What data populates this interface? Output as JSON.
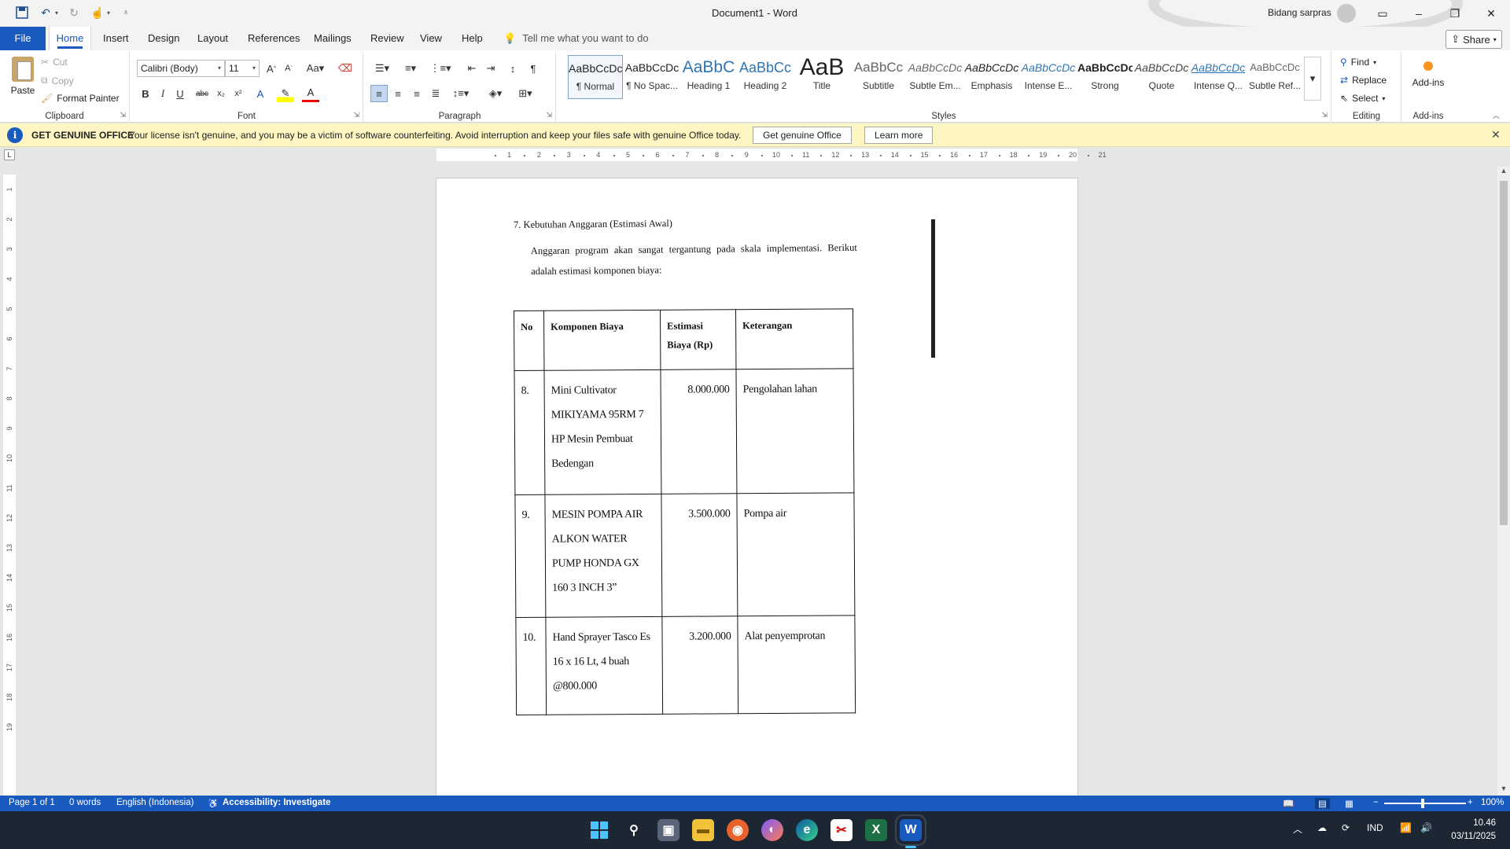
{
  "window": {
    "title": "Document1  -  Word",
    "user": "Bidang sarpras",
    "controls": {
      "minimize": "–",
      "restore": "❐",
      "close": "✕"
    }
  },
  "tabs": [
    {
      "label": "File"
    },
    {
      "label": "Home"
    },
    {
      "label": "Insert"
    },
    {
      "label": "Design"
    },
    {
      "label": "Layout"
    },
    {
      "label": "References"
    },
    {
      "label": "Mailings"
    },
    {
      "label": "Review"
    },
    {
      "label": "View"
    },
    {
      "label": "Help"
    }
  ],
  "tellme": "Tell me what you want to do",
  "share": "Share",
  "clipboard": {
    "paste": "Paste",
    "cut": "Cut",
    "copy": "Copy",
    "format_painter": "Format Painter",
    "group": "Clipboard"
  },
  "font": {
    "name": "Calibri (Body)",
    "size": "11",
    "group": "Font"
  },
  "paragraph": {
    "group": "Paragraph"
  },
  "styles": {
    "group": "Styles",
    "items": [
      {
        "preview": "AaBbCcDc",
        "name": "¶ Normal"
      },
      {
        "preview": "AaBbCcDc",
        "name": "¶ No Spac..."
      },
      {
        "preview": "AaBbC",
        "name": "Heading 1"
      },
      {
        "preview": "AaBbCc",
        "name": "Heading 2"
      },
      {
        "preview": "AaB",
        "name": "Title"
      },
      {
        "preview": "AaBbCc",
        "name": "Subtitle"
      },
      {
        "preview": "AaBbCcDc",
        "name": "Subtle Em..."
      },
      {
        "preview": "AaBbCcDc",
        "name": "Emphasis"
      },
      {
        "preview": "AaBbCcDc",
        "name": "Intense E..."
      },
      {
        "preview": "AaBbCcDc",
        "name": "Strong"
      },
      {
        "preview": "AaBbCcDc",
        "name": "Quote"
      },
      {
        "preview": "AaBbCcDc",
        "name": "Intense Q..."
      },
      {
        "preview": "AaBbCcDc",
        "name": "Subtle Ref..."
      }
    ]
  },
  "editing": {
    "find": "Find",
    "replace": "Replace",
    "select": "Select",
    "group": "Editing"
  },
  "addins": {
    "label": "Add-ins",
    "group": "Add-ins"
  },
  "notice": {
    "title": "GET GENUINE OFFICE",
    "message": "Your license isn't genuine, and you may be a victim of software counterfeiting. Avoid interruption and keep your files safe with genuine Office today.",
    "primary": "Get genuine Office",
    "secondary": "Learn more"
  },
  "document": {
    "heading": "7. Kebutuhan Anggaran (Estimasi Awal)",
    "paragraph": "Anggaran program akan sangat tergantung pada skala implementasi. Berikut adalah estimasi komponen biaya:",
    "table": {
      "headers": [
        "No",
        "Komponen Biaya",
        "Estimasi Biaya (Rp)",
        "Keterangan"
      ],
      "rows": [
        {
          "no": "8.",
          "komponen": "Mini Cultivator MIKIYAMA 95RM 7 HP Mesin Pembuat Bedengan",
          "biaya": "8.000.000",
          "keterangan": "Pengolahan lahan"
        },
        {
          "no": "9.",
          "komponen": "MESIN POMPA AIR ALKON WATER PUMP HONDA GX 160 3 INCH 3”",
          "biaya": "3.500.000",
          "keterangan": "Pompa air"
        },
        {
          "no": "10.",
          "komponen": "Hand Sprayer Tasco Es 16 x 16 Lt, 4 buah @800.000",
          "biaya": "3.200.000",
          "keterangan": "Alat penyemprotan"
        }
      ]
    }
  },
  "status": {
    "page": "Page 1 of 1",
    "words": "0 words",
    "language": "English (Indonesia)",
    "accessibility": "Accessibility: Investigate",
    "zoom": "100%"
  },
  "taskbar": {
    "lang": "IND",
    "time": "10.46",
    "date": "03/11/2025"
  }
}
